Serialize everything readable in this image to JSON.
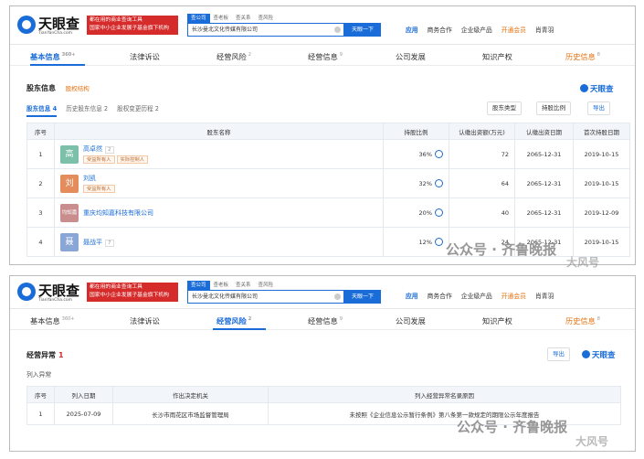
{
  "header": {
    "logo_text": "天眼查",
    "logo_sub": "TianYanCha.com",
    "slogan": [
      "都在用的商业查询工具",
      "国家中小企业发展子基金旗下机构"
    ],
    "search_tabs": [
      "查公司",
      "查老板",
      "查关系",
      "查风险"
    ],
    "search_value": "长沙曼北文化传媒有限公司",
    "search_button": "天眼一下",
    "nav": [
      "应用",
      "商务合作",
      "企业级产品",
      "开通会员",
      "肖青羽"
    ]
  },
  "screen1": {
    "tabs": [
      {
        "label": "基本信息",
        "count": "360+"
      },
      {
        "label": "法律诉讼",
        "count": ""
      },
      {
        "label": "经营风险",
        "count": "2"
      },
      {
        "label": "经营信息",
        "count": "9"
      },
      {
        "label": "公司发展",
        "count": ""
      },
      {
        "label": "知识产权",
        "count": ""
      },
      {
        "label": "历史信息",
        "count": "8"
      }
    ],
    "section_title": "股东信息",
    "equity_link": "股权结构",
    "watermark": "天眼查",
    "subtabs": [
      "股东信息 4",
      "历史股东信息 2",
      "股权变更历程 2"
    ],
    "buttons": [
      "股东类型",
      "持股比例",
      "导出"
    ],
    "columns": [
      "序号",
      "股东名称",
      "持股比例",
      "认缴出资额(万元)",
      "认缴出资日期",
      "首次持股日期"
    ],
    "rows": [
      {
        "no": "1",
        "avatar": "高",
        "name": "高卓然",
        "badge": "2",
        "tags": [
          "受益所有人",
          "实际控制人"
        ],
        "pct": "36%",
        "amount": "72",
        "date": "2065-12-31",
        "first": "2019-10-15",
        "color": "#7cc0a9"
      },
      {
        "no": "2",
        "avatar": "刘",
        "name": "刘凯",
        "badge": "",
        "tags": [
          "受益所有人"
        ],
        "pct": "32%",
        "amount": "64",
        "date": "2065-12-31",
        "first": "2019-10-15",
        "color": "#e48c5b"
      },
      {
        "no": "3",
        "avatar": "均知嘉",
        "name": "重庆均知嘉科技有限公司",
        "badge": "",
        "tags": [],
        "pct": "20%",
        "amount": "40",
        "date": "2065-12-31",
        "first": "2019-12-09",
        "color": "#c98d8d"
      },
      {
        "no": "4",
        "avatar": "聂",
        "name": "聂战平",
        "badge": "7",
        "tags": [],
        "pct": "12%",
        "amount": "24",
        "date": "2065-12-31",
        "first": "2019-10-15",
        "color": "#8aa6d6"
      }
    ]
  },
  "screen2": {
    "tabs": [
      {
        "label": "基本信息",
        "count": "360+"
      },
      {
        "label": "法律诉讼",
        "count": ""
      },
      {
        "label": "经营风险",
        "count": "2"
      },
      {
        "label": "经营信息",
        "count": "9"
      },
      {
        "label": "公司发展",
        "count": ""
      },
      {
        "label": "知识产权",
        "count": ""
      },
      {
        "label": "历史信息",
        "count": "8"
      }
    ],
    "section_title": "经营异常",
    "section_count": "1",
    "export": "导出",
    "watermark": "天眼查",
    "subsection": "列入异常",
    "columns": [
      "序号",
      "列入日期",
      "作出决定机关",
      "列入经营异常名录原因"
    ],
    "rows": [
      {
        "no": "1",
        "date": "2025-07-09",
        "org": "长沙市雨花区市场监督管理局",
        "reason": "未按照《企业信息公示暂行条例》第八条第一款规定的期限公示年度报告"
      }
    ]
  },
  "overlay": [
    "公众号 · 齐鲁晚报",
    "大风号",
    "公众号 · 齐鲁晚报",
    "大风号"
  ]
}
